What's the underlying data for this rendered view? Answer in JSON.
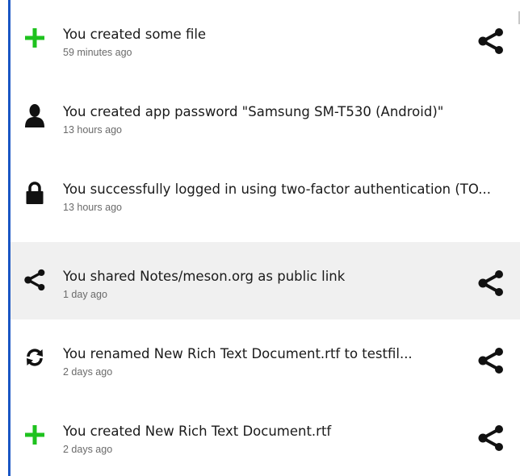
{
  "activities": [
    {
      "icon": "plus-icon",
      "title": "You created some file",
      "time": "59 minutes ago",
      "share": true
    },
    {
      "icon": "user-icon",
      "title": "You created app password \"Samsung SM-T530 (Android)\"",
      "time": "13 hours ago",
      "share": false
    },
    {
      "icon": "lock-icon",
      "title": "You successfully logged in using two-factor authentication (TO...",
      "time": "13 hours ago",
      "share": false
    },
    {
      "icon": "share-icon",
      "title": "You shared Notes/meson.org as public link",
      "time": "1 day ago",
      "share": true
    },
    {
      "icon": "rename-icon",
      "title": "You renamed New Rich Text Document.rtf to testfil...",
      "time": "2 days ago",
      "share": true
    },
    {
      "icon": "plus-icon",
      "title": "You created New Rich Text Document.rtf",
      "time": "2 days ago",
      "share": true
    }
  ],
  "colors": {
    "accent_border": "#1a56c4",
    "plus_green": "#1ec21e",
    "icon_black": "#111111",
    "hover_bg": "#f0f0f0"
  }
}
